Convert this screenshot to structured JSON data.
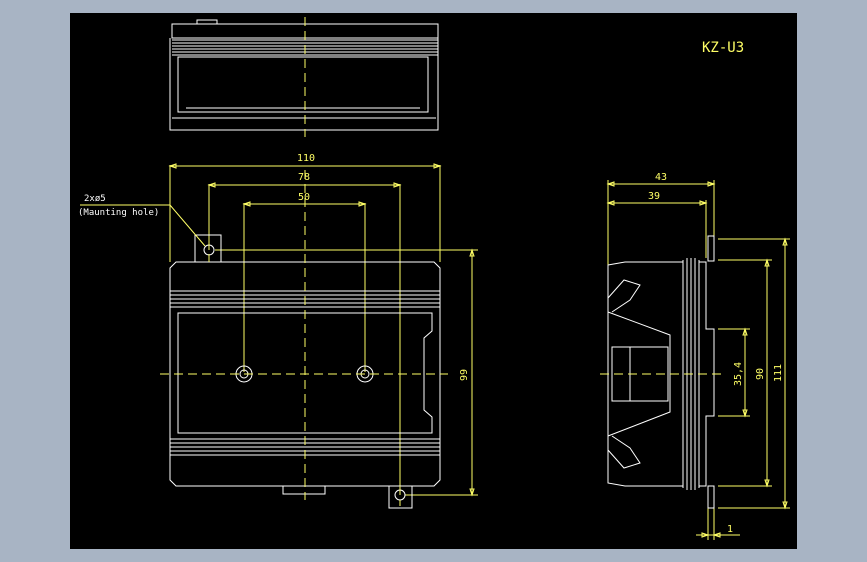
{
  "title": "KZ-U3",
  "front_view": {
    "dims": {
      "width_110": "110",
      "hole_spacing_78": "78",
      "inner_50": "50",
      "height_99": "99"
    },
    "note_line1": "2xø5",
    "note_line2": "(Maunting hole)"
  },
  "side_view": {
    "dims": {
      "depth_43": "43",
      "depth_39": "39",
      "rail_35_4": "35,4",
      "h_90": "90",
      "h_111": "111",
      "offset_1": "1"
    }
  },
  "colors": {
    "background": "#a8b4c4",
    "canvas": "#000000",
    "geometry": "#ffffff",
    "dimensions": "#ffff66"
  }
}
